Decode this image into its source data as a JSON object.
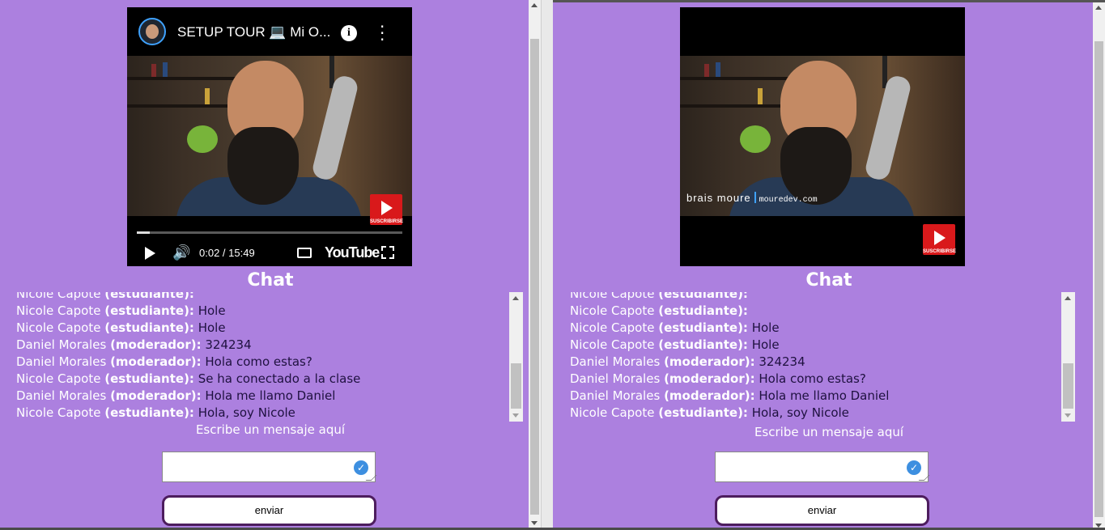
{
  "left": {
    "video": {
      "title": "SETUP TOUR 💻 Mi O...",
      "subscribe_label": "SUSCRIBIRSE",
      "time": "0:02 / 15:49",
      "logo": "YouTube",
      "progress": 0.05
    },
    "chat_title": "Chat",
    "messages": [
      {
        "user": "Nicole Capote",
        "role": "(estudiante):",
        "text": ""
      },
      {
        "user": "Nicole Capote",
        "role": "(estudiante):",
        "text": "Hole"
      },
      {
        "user": "Nicole Capote",
        "role": "(estudiante):",
        "text": "Hole"
      },
      {
        "user": "Daniel Morales",
        "role": "(moderador):",
        "text": "324234"
      },
      {
        "user": "Daniel Morales",
        "role": "(moderador):",
        "text": "Hola como estas?"
      },
      {
        "user": "Nicole Capote",
        "role": "(estudiante):",
        "text": "Se ha conectado a la clase"
      },
      {
        "user": "Daniel Morales",
        "role": "(moderador):",
        "text": "Hola me llamo Daniel"
      },
      {
        "user": "Nicole Capote",
        "role": "(estudiante):",
        "text": "Hola, soy Nicole"
      }
    ],
    "prompt": "Escribe un mensaje aquí",
    "input_value": "",
    "send_label": "enviar"
  },
  "right": {
    "video": {
      "overlay_name": "brais moure",
      "overlay_site": "mouredev.com",
      "subscribe_label": "SUSCRIBIRSE"
    },
    "chat_title": "Chat",
    "messages": [
      {
        "user": "Nicole Capote",
        "role": "(estudiante):",
        "text": ""
      },
      {
        "user": "Nicole Capote",
        "role": "(estudiante):",
        "text": ""
      },
      {
        "user": "Nicole Capote",
        "role": "(estudiante):",
        "text": "Hole"
      },
      {
        "user": "Nicole Capote",
        "role": "(estudiante):",
        "text": "Hole"
      },
      {
        "user": "Daniel Morales",
        "role": "(moderador):",
        "text": "324234"
      },
      {
        "user": "Daniel Morales",
        "role": "(moderador):",
        "text": "Hola como estas?"
      },
      {
        "user": "Daniel Morales",
        "role": "(moderador):",
        "text": "Hola me llamo Daniel"
      },
      {
        "user": "Nicole Capote",
        "role": "(estudiante):",
        "text": "Hola, soy Nicole"
      }
    ],
    "prompt": "Escribe un mensaje aquí",
    "input_value": "",
    "send_label": "enviar"
  },
  "colors": {
    "background": "#ac80df",
    "send_border": "#4d1d5e",
    "check_icon": "#3d8fe0",
    "youtube_red": "#d9191b"
  }
}
